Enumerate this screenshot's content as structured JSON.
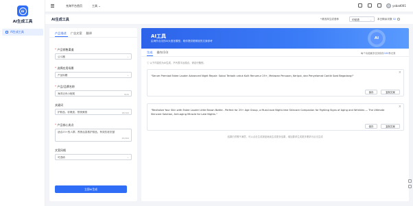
{
  "app": {
    "title": "AI生成工具",
    "logo_text": "AI"
  },
  "sidebar": {
    "items": [
      {
        "label": "AI生成工具"
      }
    ]
  },
  "topnav": {
    "links": [
      "充海平台首页",
      "工具"
    ],
    "user": "yxbad001"
  },
  "titlebar": {
    "title": "AI生成工具",
    "lang_label": "*请选择生成语种",
    "lang_value": "印尼语",
    "remaining_label": "本日剩余次数",
    "remaining_value": "52"
  },
  "form": {
    "tabs": [
      "产品描述",
      "广告文案",
      "翻译"
    ],
    "fields": [
      {
        "label": "产品销售渠道",
        "required": true,
        "value": "公斗器",
        "kind": "select"
      },
      {
        "label": "选择应用场景",
        "required": true,
        "value": "产品标题",
        "kind": "select"
      },
      {
        "label": "产品/品牌名称",
        "required": true,
        "value": "海洋泛舟小程现",
        "count": "8/20",
        "kind": "input"
      },
      {
        "label": "关键词",
        "required": false,
        "value": "护肤品、彩裹皮、熬夜美丽",
        "count": "18/100",
        "kind": "input"
      },
      {
        "label": "产品核心卖点",
        "required": true,
        "value": "适合25+的人群，熬夜后急救护肤品，有效抗老抗皱",
        "count": "25/300",
        "kind": "area"
      },
      {
        "label": "文案风格",
        "required": false,
        "value": "可选填",
        "kind": "select"
      }
    ],
    "submit_label": "立即AI生成"
  },
  "result": {
    "banner_title": "AI工具",
    "banner_subtitle": "由海外合法的AI大语言模型，助你提供更精准的文案参考",
    "banner_badge": "AI",
    "tabs": [
      "生成",
      "操作(10)"
    ],
    "history_note_prefix": "每个功能最多支持保存",
    "history_note_count": "100",
    "history_note_suffix": "条记录",
    "hint": "以下内容仅为AI生成，不代表平台观点，请自行甄别。",
    "cards": [
      {
        "text": "\"Serum Premiad Estee Lauder Advanced Night Repair: Solusi Terbaik untuk Kulit Renumur 25+, Melawan Penuaan, Keriput, dan Penyelamat Cantik Saat Begadang!\"",
        "btn_save": "保存",
        "btn_copy": "复制文案"
      },
      {
        "text": "\"Revitalize Your Skin with Estee Lauder Little Brown Bottle - Perfect for 25+ Age Group, a Must-have Night-time Skincare Companion for Fighting Signs of Aging and Wrinkles — The Ultimate Skincare Solution, Anti-aging Miracle for Late Nights.\"",
        "btn_save": "保存",
        "btn_copy": "复制文案"
      }
    ],
    "footer": "结果仍然需不满意，可以点击生成按钮继续生成更多结果，增加要求生成更多需求可点击生成"
  }
}
